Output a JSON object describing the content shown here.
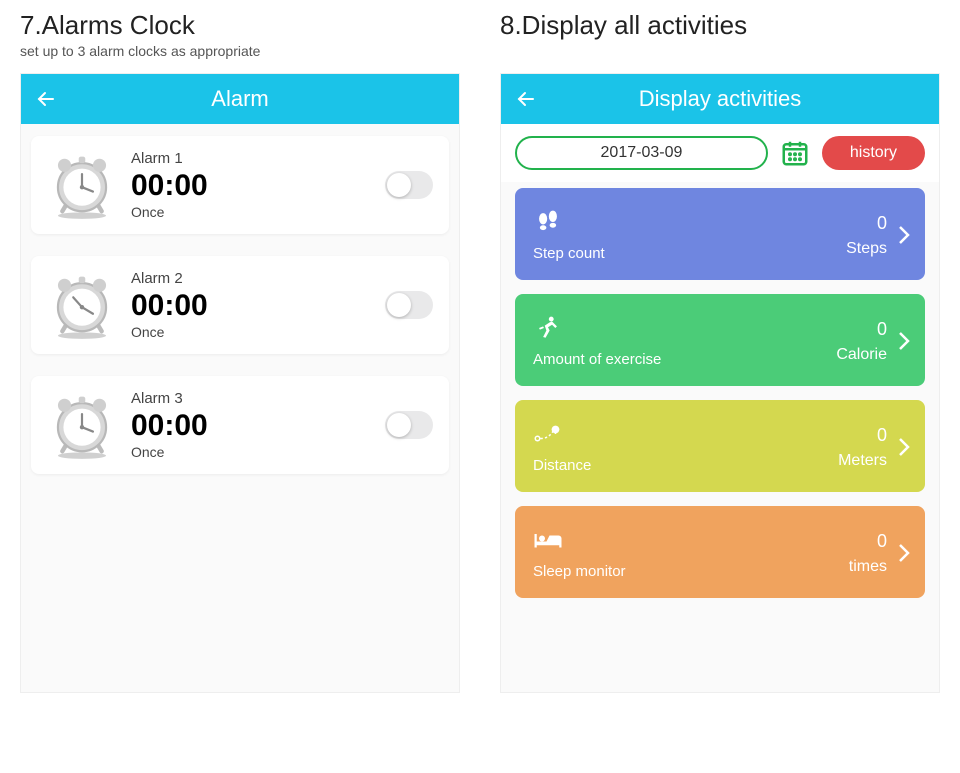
{
  "left": {
    "heading": "7.Alarms Clock",
    "sub": "set up to 3 alarm clocks as appropriate",
    "appbar_title": "Alarm",
    "alarms": [
      {
        "name": "Alarm 1",
        "time": "00:00",
        "repeat": "Once"
      },
      {
        "name": "Alarm 2",
        "time": "00:00",
        "repeat": "Once"
      },
      {
        "name": "Alarm 3",
        "time": "00:00",
        "repeat": "Once"
      }
    ]
  },
  "right": {
    "heading": "8.Display all activities",
    "sub": "",
    "appbar_title": "Display activities",
    "date": "2017-03-09",
    "history_label": "history",
    "cards": [
      {
        "label": "Step count",
        "value": "0",
        "unit": "Steps",
        "color": "#6f86e0"
      },
      {
        "label": "Amount of exercise",
        "value": "0",
        "unit": "Calorie",
        "color": "#4bcc78"
      },
      {
        "label": "Distance",
        "value": "0",
        "unit": "Meters",
        "color": "#d4d84f"
      },
      {
        "label": "Sleep monitor",
        "value": "0",
        "unit": "times",
        "color": "#f0a35e"
      }
    ]
  }
}
